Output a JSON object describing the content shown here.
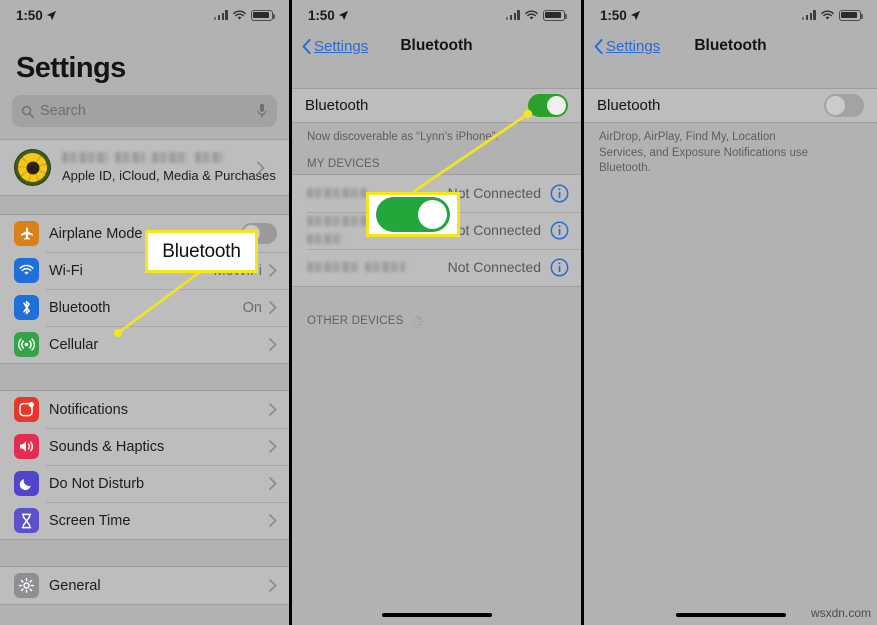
{
  "watermark": "wsxdn.com",
  "status_bar": {
    "time": "1:50",
    "location_icon": "location-arrow-icon",
    "signal_icon": "cellular-signal-icon",
    "wifi_icon": "wifi-icon",
    "battery_icon": "battery-icon"
  },
  "panel1": {
    "title": "Settings",
    "search": {
      "placeholder": "Search",
      "icon": "search-icon",
      "mic_icon": "microphone-icon"
    },
    "account": {
      "name_redacted": true,
      "subtitle": "Apple ID, iCloud, Media & Purchases"
    },
    "group1": [
      {
        "label": "Airplane Mode",
        "icon": "airplane-icon",
        "color": "#d9801a",
        "control": "toggle",
        "toggle_on": false
      },
      {
        "label": "Wi-Fi",
        "icon": "wifi-icon",
        "color": "#1e6fd9",
        "control": "chevron",
        "value": "McWiFi"
      },
      {
        "label": "Bluetooth",
        "icon": "bluetooth-icon",
        "color": "#1e6fd9",
        "control": "chevron",
        "value": "On"
      },
      {
        "label": "Cellular",
        "icon": "cellular-icon",
        "color": "#36a34b",
        "control": "chevron",
        "value": ""
      }
    ],
    "group2": [
      {
        "label": "Notifications",
        "icon": "notifications-icon",
        "color": "#e5372b",
        "control": "chevron",
        "value": ""
      },
      {
        "label": "Sounds & Haptics",
        "icon": "sounds-icon",
        "color": "#e52b50",
        "control": "chevron",
        "value": ""
      },
      {
        "label": "Do Not Disturb",
        "icon": "moon-icon",
        "color": "#4f46c9",
        "control": "chevron",
        "value": ""
      },
      {
        "label": "Screen Time",
        "icon": "hourglass-icon",
        "color": "#5a52cc",
        "control": "chevron",
        "value": ""
      }
    ],
    "group3": [
      {
        "label": "General",
        "icon": "gear-icon",
        "color": "#8e8e93",
        "control": "chevron",
        "value": ""
      }
    ],
    "callout": {
      "text": "Bluetooth",
      "border_color": "#f5e61a"
    }
  },
  "panel2": {
    "nav": {
      "back_label": "Settings",
      "back_icon": "chevron-left-icon",
      "title": "Bluetooth"
    },
    "bluetooth_row": {
      "label": "Bluetooth",
      "toggle_on": true
    },
    "footnote": "Now discoverable as “Lynn’s iPhone”.",
    "my_devices_header": "MY DEVICES",
    "devices": [
      {
        "name_redacted": true,
        "state": "Not Connected",
        "info_icon": "info-circle-icon"
      },
      {
        "name_redacted": true,
        "state": "Not Connected",
        "info_icon": "info-circle-icon"
      },
      {
        "name_redacted": true,
        "state": "Not Connected",
        "info_icon": "info-circle-icon"
      }
    ],
    "other_devices_header": "OTHER DEVICES",
    "spinner_icon": "loading-spinner-icon",
    "highlight": {
      "toggle_on": true,
      "border_color": "#f5e61a"
    }
  },
  "panel3": {
    "nav": {
      "back_label": "Settings",
      "back_icon": "chevron-left-icon",
      "title": "Bluetooth"
    },
    "bluetooth_row": {
      "label": "Bluetooth",
      "toggle_on": false
    },
    "footnote": "AirDrop, AirPlay, Find My, Location Services, and Exposure Notifications use Bluetooth."
  }
}
